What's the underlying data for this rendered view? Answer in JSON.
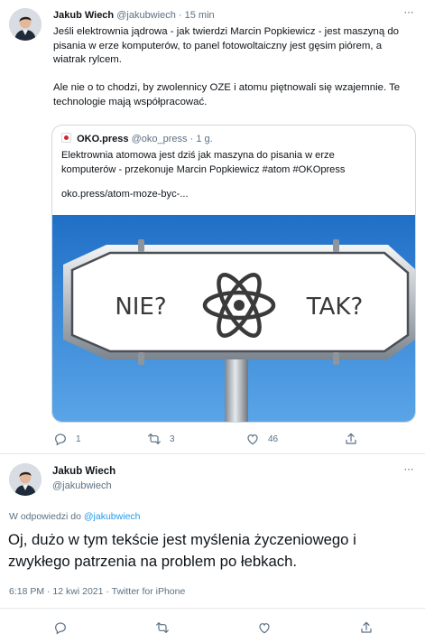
{
  "tweet": {
    "name": "Jakub Wiech",
    "handle": "@jakubwiech",
    "separator": "·",
    "time": "15 min",
    "text": "Jeśli elektrownia jądrowa - jak twierdzi Marcin Popkiewicz - jest maszyną do\npisania w erze komputerów, to panel fotowoltaiczny jest gęsim piórem, a\nwiatrak rylcem.\n\nAle nie o to chodzi, by zwolennicy OZE i atomu piętnowali się wzajemnie. Te\ntechnologie mają współpracować.",
    "quote": {
      "name": "OKO.press",
      "handle": "@oko_press",
      "separator": "·",
      "time": "1 g.",
      "text": "Elektrownia atomowa jest dziś jak maszyna do pisania w erze\nkomputerów - przekonuje Marcin Popkiewicz #atom #OKOpress",
      "link": "oko.press/atom-moze-byc-...",
      "image": {
        "left_label": "NIE?",
        "right_label": "TAK?",
        "icon": "atom-icon"
      }
    },
    "actions": {
      "reply_count": "1",
      "retweet_count": "3",
      "like_count": "46"
    }
  },
  "reply": {
    "name": "Jakub Wiech",
    "handle": "@jakubwiech",
    "replying_prefix": "W odpowiedzi do",
    "replying_to": "@jakubwiech",
    "text": "Oj, dużo w tym tekście jest myślenia życzeniowego i\nzwykłego patrzenia na problem po łebkach.",
    "meta": "6:18 PM · 12 kwi 2021 · Twitter for iPhone"
  },
  "more_icon": "⋯",
  "colors": {
    "accent": "#1d9bf0",
    "secondary_text": "#5b7083",
    "border": "#cfd9de",
    "sky": "#2f86d6"
  }
}
